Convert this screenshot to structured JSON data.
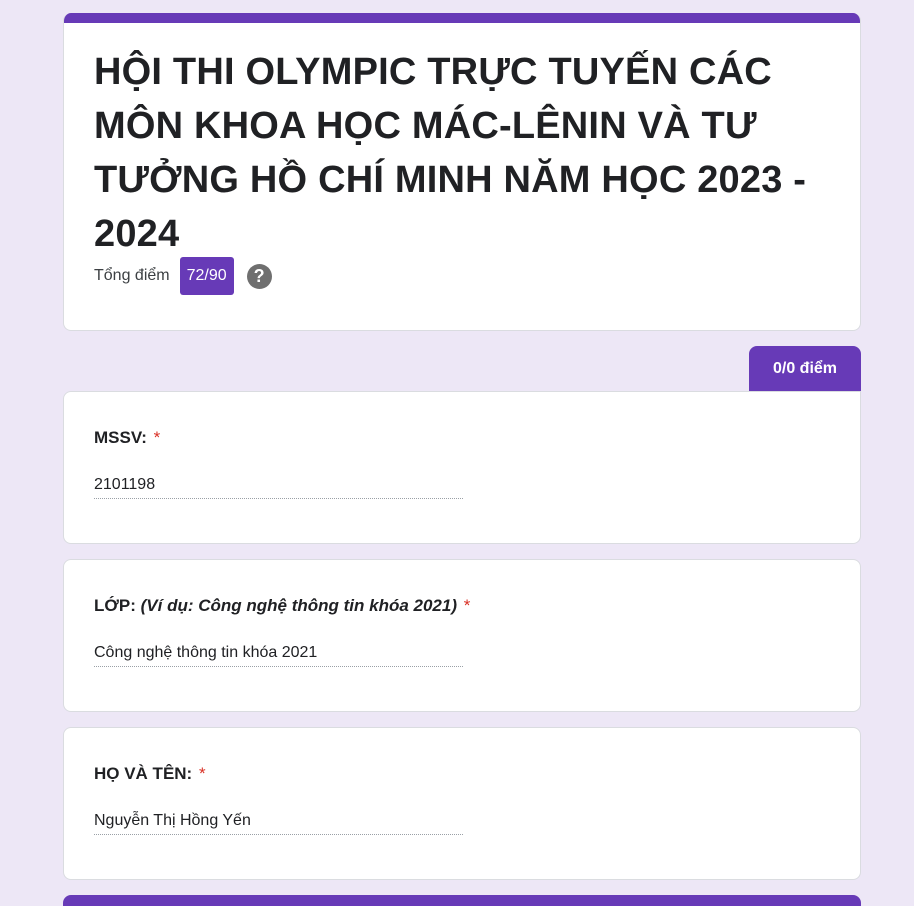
{
  "header": {
    "title": "HỘI THI OLYMPIC TRỰC TUYẾN CÁC MÔN KHOA HỌC MÁC-LÊNIN VÀ TƯ TƯỞNG HỒ CHÍ MINH NĂM HỌC 2023 - 2024",
    "total_label": "Tổng điểm",
    "total_score": "72/90",
    "help_icon": "question-circle-icon"
  },
  "section": {
    "points": "0/0 điểm"
  },
  "questions": [
    {
      "label": "MSSV:",
      "hint": "",
      "required_mark": "*",
      "answer": "2101198"
    },
    {
      "label": "LỚP:",
      "hint": "(Ví dụ: Công nghệ thông tin khóa 2021)",
      "required_mark": "*",
      "answer": "Công nghệ thông tin khóa 2021"
    },
    {
      "label": "HỌ VÀ TÊN:",
      "hint": "",
      "required_mark": "*",
      "answer": "Nguyễn Thị Hồng Yến"
    }
  ],
  "colors": {
    "accent": "#673ab7",
    "background": "#ede7f6",
    "required": "#d93025"
  }
}
